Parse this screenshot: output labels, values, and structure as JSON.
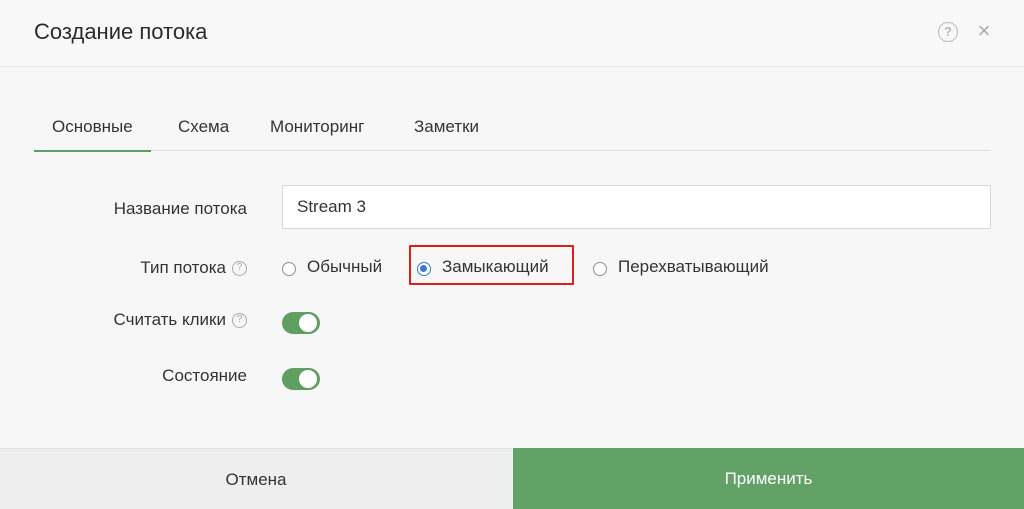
{
  "dialog": {
    "title": "Создание потока"
  },
  "header": {
    "help_icon": "?",
    "close_icon": "×"
  },
  "tabs": [
    {
      "label": "Основные",
      "active": true
    },
    {
      "label": "Схема",
      "active": false
    },
    {
      "label": "Мониторинг",
      "active": false
    },
    {
      "label": "Заметки",
      "active": false
    }
  ],
  "form": {
    "name_label": "Название потока",
    "name_value": "Stream 3",
    "type_label": "Тип потока",
    "type_options": [
      {
        "label": "Обычный",
        "checked": false
      },
      {
        "label": "Замыкающий",
        "checked": true
      },
      {
        "label": "Перехватывающий",
        "checked": false
      }
    ],
    "count_clicks_label": "Считать клики",
    "count_clicks_on": true,
    "state_label": "Состояние",
    "state_on": true,
    "help_glyph": "?"
  },
  "footer": {
    "cancel_label": "Отмена",
    "apply_label": "Применить"
  },
  "colors": {
    "accent": "#63a266",
    "radio_selected": "#3b78d8",
    "highlight": "#e21b1b"
  }
}
